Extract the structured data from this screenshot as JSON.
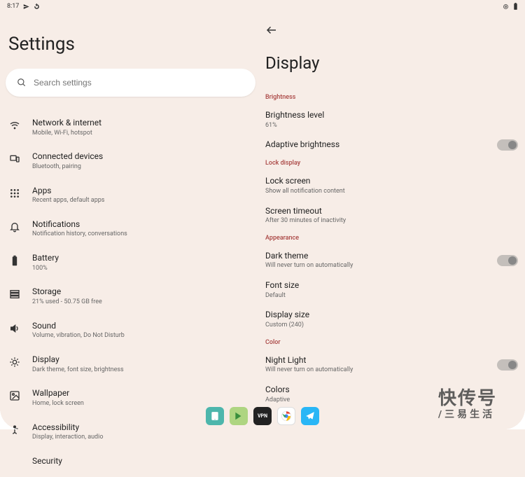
{
  "status": {
    "time": "8:17",
    "icons_left": [
      "send-icon",
      "sync-icon"
    ],
    "icons_right": [
      "signal-icon",
      "battery-icon"
    ]
  },
  "left": {
    "title": "Settings",
    "search": {
      "placeholder": "Search settings"
    },
    "items": [
      {
        "icon": "wifi-icon",
        "title": "Network & internet",
        "sub": "Mobile, Wi-Fi, hotspot"
      },
      {
        "icon": "devices-icon",
        "title": "Connected devices",
        "sub": "Bluetooth, pairing"
      },
      {
        "icon": "apps-icon",
        "title": "Apps",
        "sub": "Recent apps, default apps"
      },
      {
        "icon": "bell-icon",
        "title": "Notifications",
        "sub": "Notification history, conversations"
      },
      {
        "icon": "battery-icon",
        "title": "Battery",
        "sub": "100%"
      },
      {
        "icon": "storage-icon",
        "title": "Storage",
        "sub": "21% used - 50.75 GB free"
      },
      {
        "icon": "sound-icon",
        "title": "Sound",
        "sub": "Volume, vibration, Do Not Disturb"
      },
      {
        "icon": "display-icon",
        "title": "Display",
        "sub": "Dark theme, font size, brightness"
      },
      {
        "icon": "wallpaper-icon",
        "title": "Wallpaper",
        "sub": "Home, lock screen"
      },
      {
        "icon": "accessibility-icon",
        "title": "Accessibility",
        "sub": "Display, interaction, audio"
      },
      {
        "icon": "security-icon",
        "title": "Security",
        "sub": ""
      }
    ]
  },
  "right": {
    "title": "Display",
    "sections": [
      {
        "header": "Brightness",
        "rows": [
          {
            "title": "Brightness level",
            "sub": "61%",
            "toggle": false
          },
          {
            "title": "Adaptive brightness",
            "sub": "",
            "toggle": true,
            "toggle_on": false
          }
        ]
      },
      {
        "header": "Lock display",
        "rows": [
          {
            "title": "Lock screen",
            "sub": "Show all notification content",
            "toggle": false
          },
          {
            "title": "Screen timeout",
            "sub": "After 30 minutes of inactivity",
            "toggle": false
          }
        ]
      },
      {
        "header": "Appearance",
        "rows": [
          {
            "title": "Dark theme",
            "sub": "Will never turn on automatically",
            "toggle": true,
            "toggle_on": false
          },
          {
            "title": "Font size",
            "sub": "Default",
            "toggle": false
          },
          {
            "title": "Display size",
            "sub": "Custom (240)",
            "toggle": false
          }
        ]
      },
      {
        "header": "Color",
        "rows": [
          {
            "title": "Night Light",
            "sub": "Will never turn on automatically",
            "toggle": true,
            "toggle_on": false
          },
          {
            "title": "Colors",
            "sub": "Adaptive",
            "toggle": false
          }
        ]
      }
    ]
  },
  "taskbar": [
    {
      "name": "phone-app",
      "color": "#4db6ac"
    },
    {
      "name": "play-store",
      "color": "#aed581"
    },
    {
      "name": "dark-app",
      "color": "#222"
    },
    {
      "name": "chrome",
      "color": "#fff"
    },
    {
      "name": "telegram",
      "color": "#29b6f6"
    }
  ],
  "watermark": {
    "main": "快传号",
    "sub": "/三易生活"
  }
}
